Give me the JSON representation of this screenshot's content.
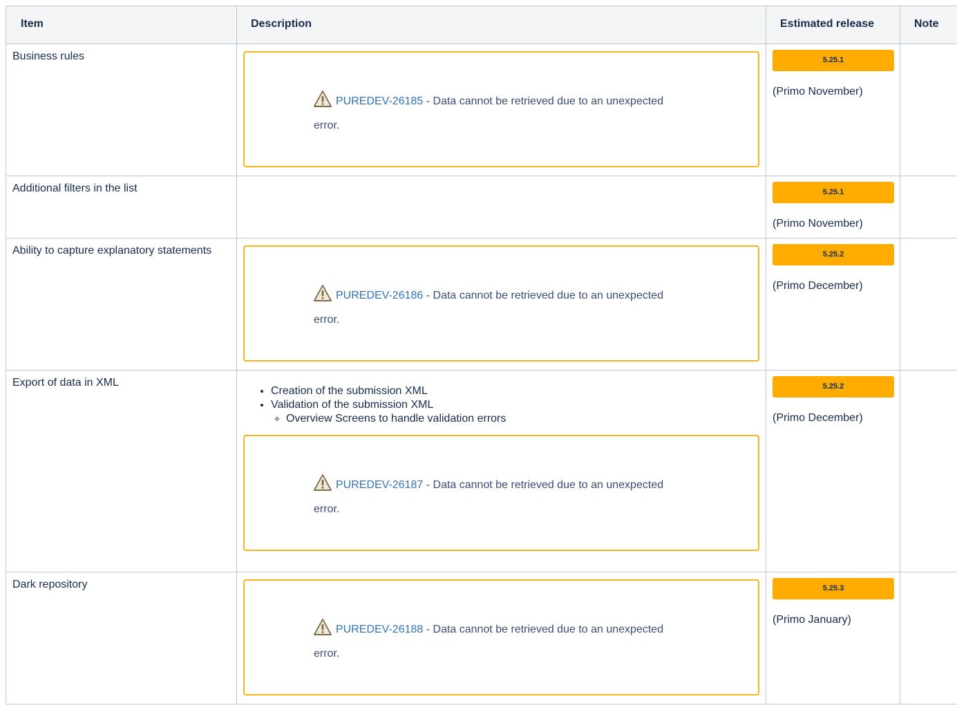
{
  "headers": {
    "item": "Item",
    "description": "Description",
    "release": "Estimated release",
    "note": "Note"
  },
  "rows": [
    {
      "item": "Business rules",
      "jira_key": "PUREDEV-26185",
      "jira_msg": " - Data cannot be retrieved due to an unexpected",
      "jira_msg2": "error.",
      "release": "5.25.1",
      "release_note": "(Primo November)"
    },
    {
      "item": "Additional filters in the list",
      "release": "5.25.1",
      "release_note": "(Primo November)"
    },
    {
      "item": "Ability to capture explanatory statements",
      "jira_key": "PUREDEV-26186",
      "jira_msg": " - Data cannot be retrieved due to an unexpected",
      "jira_msg2": "error.",
      "release": "5.25.2",
      "release_note": "(Primo December)"
    },
    {
      "item": "Export of data in XML",
      "bullets": [
        "Creation of the submission XML",
        "Validation of the submission XML"
      ],
      "sub_bullets": [
        "Overview Screens to handle validation errors"
      ],
      "jira_key": "PUREDEV-26187",
      "jira_msg": " - Data cannot be retrieved due to an unexpected",
      "jira_msg2": "error.",
      "release": "5.25.2",
      "release_note": "(Primo December)"
    },
    {
      "item": "Dark repository",
      "jira_key": "PUREDEV-26188",
      "jira_msg": " - Data cannot be retrieved due to an unexpected",
      "jira_msg2": "error.",
      "release": "5.25.3",
      "release_note": "(Primo January)"
    }
  ],
  "colors": {
    "badge": "#ffab00",
    "jira_border": "#f9b51d",
    "link": "#3572b0"
  },
  "icons": {
    "jira_warning": "warning-icon"
  }
}
